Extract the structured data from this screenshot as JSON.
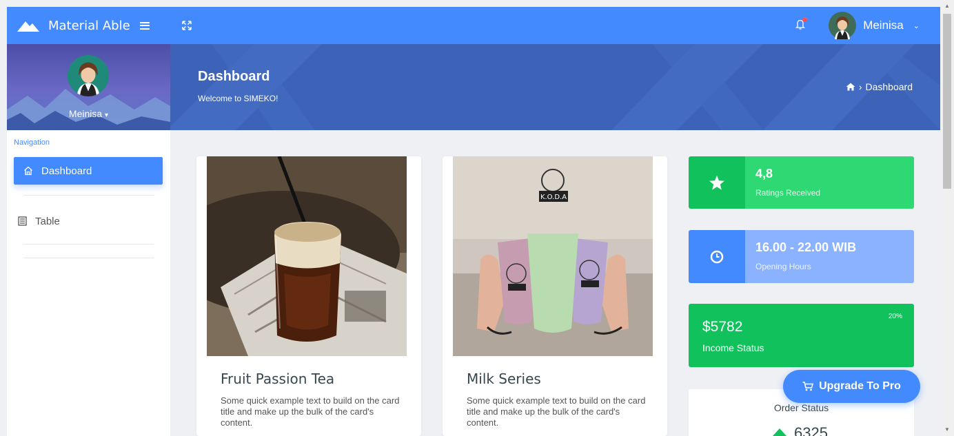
{
  "topbar": {
    "brand": "Material Able",
    "user_name": "Meinisa",
    "user_chevron": "⌄"
  },
  "sidebar": {
    "profile_name": "Meinisa",
    "profile_caret": "▾",
    "nav_label": "Navigation",
    "items": [
      {
        "label": "Dashboard",
        "icon": "home-icon",
        "active": true
      },
      {
        "label": "Table",
        "icon": "table-icon",
        "active": false
      }
    ]
  },
  "header": {
    "title": "Dashboard",
    "subtitle": "Welcome to SIMEKO!",
    "breadcrumb_sep": "›",
    "breadcrumb": "Dashboard"
  },
  "cards": [
    {
      "title": "Fruit Passion Tea",
      "text": "Some quick example text to build on the card title and make up the bulk of the card's content."
    },
    {
      "title": "Milk Series",
      "text": "Some quick example text to build on the card title and make up the bulk of the card's content."
    }
  ],
  "stats": {
    "ratings": {
      "value": "4,8",
      "label": "Ratings Received"
    },
    "hours": {
      "value": "16.00 - 22.00 WIB",
      "label": "Opening Hours"
    }
  },
  "income": {
    "value": "$5782",
    "label": "Income Status",
    "percent": "20%"
  },
  "order": {
    "title": "Order Status",
    "value": "6325"
  },
  "upgrade": {
    "label": "Upgrade To Pro"
  },
  "colors": {
    "primary": "#448aff",
    "success": "#11c15b",
    "success_light": "#2ed872",
    "info_light": "#8ab2ff",
    "banner": "#3d63b8"
  }
}
